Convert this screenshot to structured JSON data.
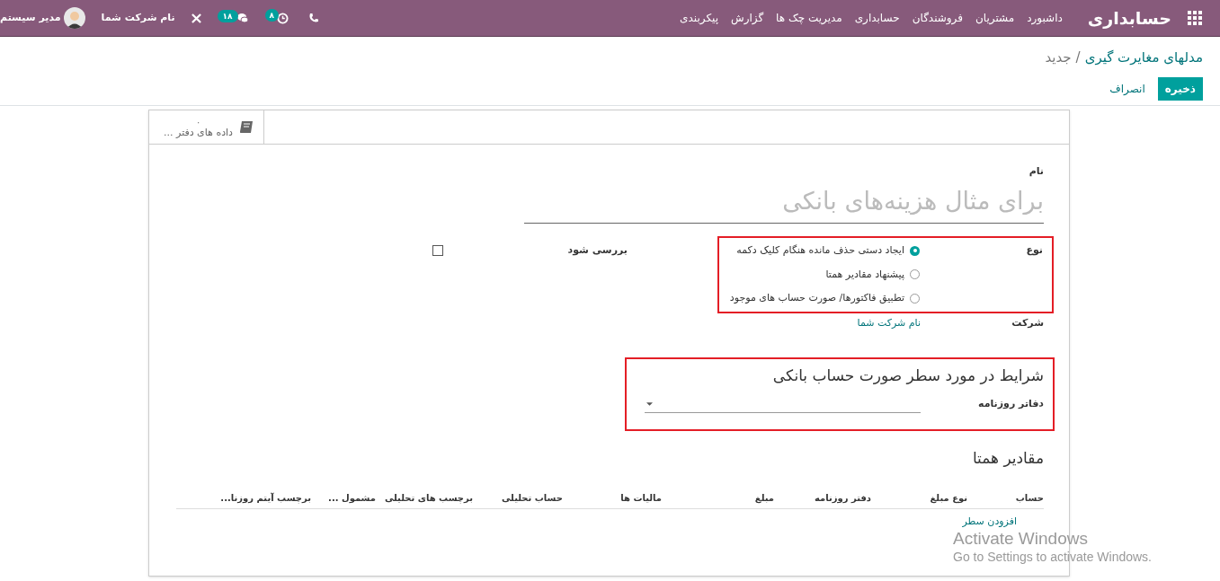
{
  "navbar": {
    "app_title": "حسابداری",
    "menu": [
      "داشبورد",
      "مشتریان",
      "فروشندگان",
      "حسابداری",
      "مدیریت چک ها",
      "گزارش",
      "پیکربندی"
    ],
    "activity_count": "۸",
    "message_count": "۱۸",
    "company": "نام شرکت شما",
    "user": "مدیر سیستم"
  },
  "breadcrumb": {
    "parent": "مدلهای مغایرت گیری",
    "separator": "/",
    "current": "جدید"
  },
  "buttons": [
    {
      "label": "ذخیره",
      "kind": "primary"
    },
    {
      "label": "انصراف",
      "kind": "secondary"
    }
  ],
  "smart_button": {
    "count": "۰",
    "label": "داده های دفتر ..."
  },
  "form": {
    "name_label": "نام",
    "name_placeholder": "برای مثال هزینه‌های بانکی",
    "type": {
      "label": "نوع",
      "highlighted": true,
      "options": [
        {
          "label": "ایجاد دستی حذف مانده هنگام کلیک دکمه",
          "selected": true
        },
        {
          "label": "پیشنهاد مقادیر همتا",
          "selected": false
        },
        {
          "label": "تطبیق فاکتورها/ صورت حساب های موجود",
          "selected": false
        }
      ]
    },
    "review": {
      "label": "بررسی شود",
      "checked": false
    },
    "company": {
      "label": "شرکت",
      "value": "نام شرکت شما"
    },
    "conditions": {
      "title": "شرایط در مورد سطر صورت حساب بانکی",
      "highlighted": true,
      "journal_label": "دفاتر روزنامه"
    },
    "counterpart": {
      "title": "مقادیر همتا",
      "columns": [
        "حساب",
        "نوع مبلغ",
        "دفتر روزنامه",
        "مبلغ",
        "مالیات ها",
        "حساب تحلیلی",
        "برچسب های تحلیلی",
        "مشمول ...",
        "برچسب آیتم روزنا..."
      ],
      "add_line": "افزودن سطر"
    }
  },
  "os_overlay": {
    "title": "Activate Windows",
    "subtitle": "Go to Settings to activate Windows."
  }
}
